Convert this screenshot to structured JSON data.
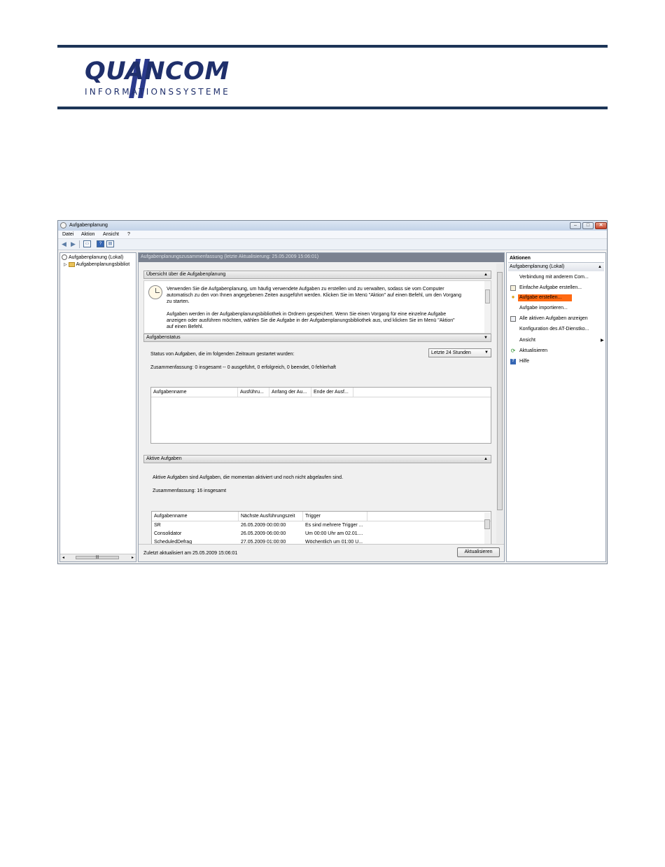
{
  "logo": {
    "name": "QUANCOM",
    "subtitle": "INFORMATIONSSYSTEME"
  },
  "window": {
    "title": "Aufgabenplanung",
    "menu": [
      "Datei",
      "Aktion",
      "Ansicht",
      "?"
    ]
  },
  "tree": {
    "root": "Aufgabenplanung  (Lokal)",
    "child": "Aufgabenplanungsbibliot"
  },
  "center": {
    "header": "Aufgabenplanungszusammenfassung (letzte Aktualisierung: 25.05.2009 15:06:01)",
    "overview": {
      "title": "Übersicht über die Aufgabenplanung",
      "lines1": [
        "Verwenden Sie die Aufgabenplanung, um häufig verwendete Aufgaben zu erstellen und zu verwalten, sodass sie vom Computer",
        "automatisch zu den von Ihnen angegebenen Zeiten ausgeführt werden. Klicken Sie im Menü \"Aktion\" auf einen Befehl, um den Vorgang",
        "zu starten."
      ],
      "lines2": [
        "Aufgaben werden in der Aufgabenplanungsbibliothek in Ordnern gespeichert. Wenn Sie einen Vorgang für eine einzelne Aufgabe",
        "anzeigen oder ausführen möchten, wählen Sie die Aufgabe in der Aufgabenplanungsbibliothek aus, und klicken Sie im Menü \"Aktion\"",
        "auf einen Befehl."
      ]
    },
    "status": {
      "title": "Aufgabenstatus",
      "label": "Status von Aufgaben, die im folgenden Zeitraum gestartet wurden:",
      "range": "Letzte 24 Stunden",
      "summary": "Zusammenfassung: 0 insgesamt -- 0 ausgeführt, 0 erfolgreich, 0 beendet, 0 fehlerhaft",
      "columns": [
        "Aufgabenname",
        "Ausführu...",
        "Anfang der Au...",
        "Ende der Ausf..."
      ]
    },
    "active": {
      "title": "Aktive Aufgaben",
      "desc": "Aktive Aufgaben sind Aufgaben, die momentan aktiviert und noch nicht abgelaufen sind.",
      "summary": "Zusammenfassung: 16 insgesamt",
      "columns": [
        "Aufgabenname",
        "Nächste Ausführungszeit",
        "Trigger"
      ],
      "rows": [
        [
          "SR",
          "26.05.2009 00:00:00",
          "Es sind mehrere Trigger ..."
        ],
        [
          "Consolidator",
          "26.05.2009 06:00:00",
          "Um 00:00 Uhr am 02.01...."
        ],
        [
          "ScheduledDefrag",
          "27.05.2009 01:00:00",
          "Wöchentlich um 01:00 U..."
        ]
      ]
    },
    "footer": "Zuletzt aktualisiert am 25.05.2009 15:06:01",
    "refresh": "Aktualisieren"
  },
  "actions": {
    "title": "Aktionen",
    "group": "Aufgabenplanung  (Lokal)",
    "items": [
      "Verbindung mit anderem Com...",
      "Einfache Aufgabe erstellen...",
      "Aufgabe erstellen...",
      "Aufgabe importieren...",
      "Alle aktiven Aufgaben anzeigen",
      "Konfiguration des AT-Dienstko...",
      "Ansicht",
      "Aktualisieren",
      "Hilfe"
    ]
  }
}
